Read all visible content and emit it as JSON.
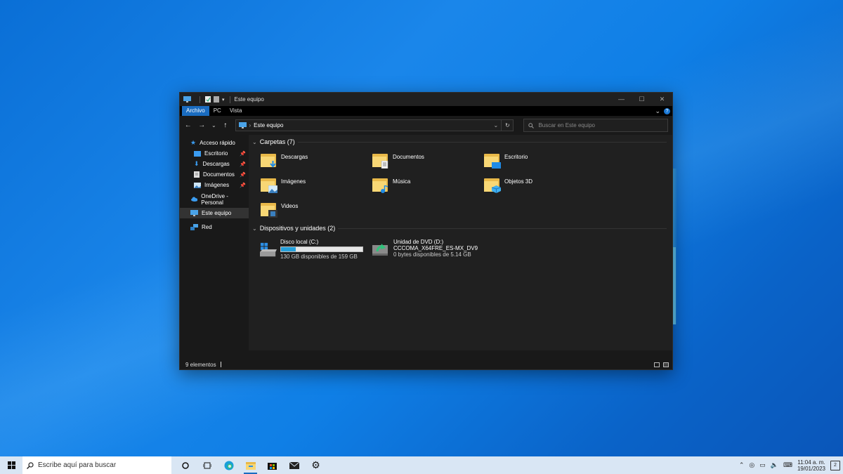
{
  "window": {
    "title": "Este equipo",
    "controls": {
      "minimize": "—",
      "maximize": "☐",
      "close": "✕"
    }
  },
  "ribbon": {
    "tabs": [
      "Archivo",
      "PC",
      "Vista"
    ],
    "active_tab": "Archivo",
    "help": "?"
  },
  "navigation": {
    "back": "←",
    "forward": "→",
    "recent": "⌄",
    "up": "↑",
    "address": "Este equipo",
    "address_separator": "›",
    "refresh": "↻",
    "search_placeholder": "Buscar en Este equipo"
  },
  "sidebar": {
    "items": [
      {
        "label": "Acceso rápido",
        "icon": "star-icon",
        "pinned": false
      },
      {
        "label": "Escritorio",
        "icon": "desktop-folder-icon",
        "pinned": true
      },
      {
        "label": "Descargas",
        "icon": "download-icon",
        "pinned": true
      },
      {
        "label": "Documentos",
        "icon": "document-icon",
        "pinned": true
      },
      {
        "label": "Imágenes",
        "icon": "image-icon",
        "pinned": true
      },
      {
        "label": "OneDrive - Personal",
        "icon": "cloud-icon",
        "pinned": false
      },
      {
        "label": "Este equipo",
        "icon": "computer-icon",
        "pinned": false,
        "selected": true
      },
      {
        "label": "Red",
        "icon": "network-icon",
        "pinned": false
      }
    ]
  },
  "content": {
    "folders_header": "Carpetas (7)",
    "folders": [
      {
        "label": "Descargas",
        "icon": "downloads-folder-icon"
      },
      {
        "label": "Documentos",
        "icon": "documents-folder-icon"
      },
      {
        "label": "Escritorio",
        "icon": "desktop-folder-icon"
      },
      {
        "label": "Imágenes",
        "icon": "pictures-folder-icon"
      },
      {
        "label": "Música",
        "icon": "music-folder-icon"
      },
      {
        "label": "Objetos 3D",
        "icon": "3d-objects-folder-icon"
      },
      {
        "label": "Videos",
        "icon": "videos-folder-icon"
      }
    ],
    "devices_header": "Dispositivos y unidades (2)",
    "devices": [
      {
        "name": "Disco local (C:)",
        "free": "130 GB disponibles de 159 GB",
        "used_fraction": 0.18,
        "icon": "hard-drive-icon"
      },
      {
        "name": "Unidad de DVD (D:)",
        "label": "CCCOMA_X64FRE_ES-MX_DV9",
        "free": "0 bytes disponibles de 5.14 GB",
        "icon": "dvd-drive-icon"
      }
    ]
  },
  "status": {
    "count": "9 elementos"
  },
  "taskbar": {
    "search_placeholder": "Escribe aquí para buscar",
    "time": "11:04 a. m.",
    "date": "19/01/2023",
    "notifications_count": "2"
  },
  "colors": {
    "accent": "#1a6cc0",
    "window_bg": "#191919",
    "content_bg": "#202020",
    "folder": "#f8d775"
  }
}
